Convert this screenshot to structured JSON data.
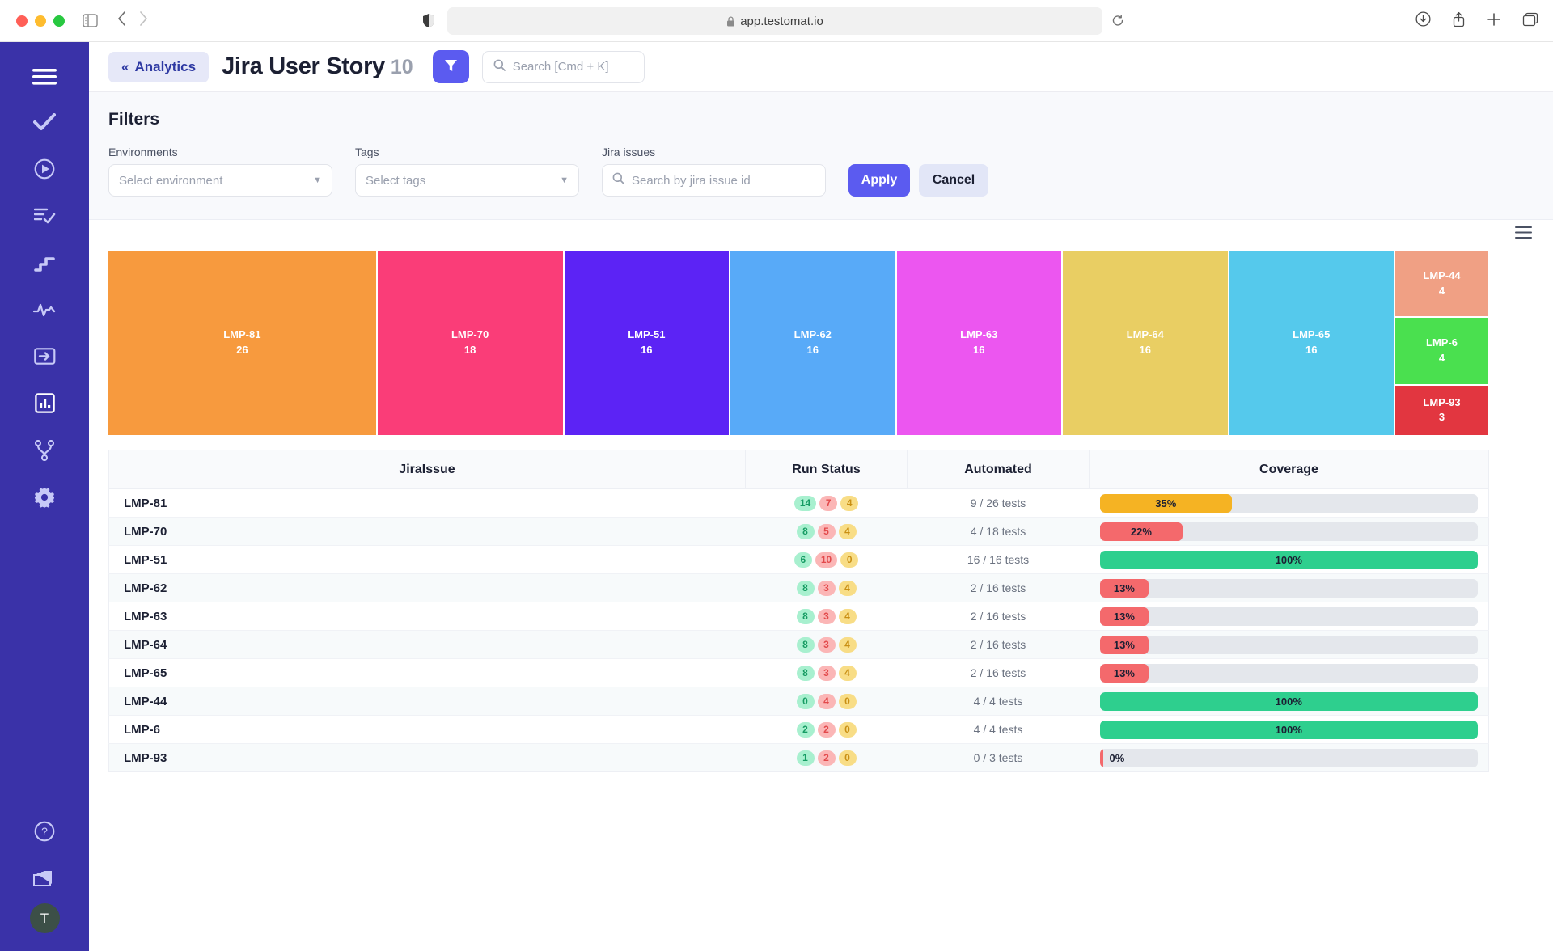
{
  "browser": {
    "url": "app.testomat.io",
    "lock_icon": "lock-icon",
    "shield_icon": "shield-icon",
    "sidebar_toggle_icon": "sidebar-toggle-icon",
    "back_icon": "back-arrow-icon",
    "forward_icon": "forward-arrow-icon",
    "reload_icon": "reload-icon",
    "download_icon": "download-icon",
    "share_icon": "share-icon",
    "new_tab_icon": "new-tab-icon",
    "tabs_icon": "tab-overview-icon"
  },
  "sidebar": {
    "items": [
      {
        "icon": "hamburger-menu-icon",
        "name": "menu"
      },
      {
        "icon": "check-icon",
        "name": "tests"
      },
      {
        "icon": "play-circle-icon",
        "name": "runs"
      },
      {
        "icon": "list-check-icon",
        "name": "plans"
      },
      {
        "icon": "stairs-icon",
        "name": "steps"
      },
      {
        "icon": "pulse-icon",
        "name": "activity"
      },
      {
        "icon": "import-icon",
        "name": "import"
      },
      {
        "icon": "bar-chart-icon",
        "name": "analytics"
      },
      {
        "icon": "branch-icon",
        "name": "branches"
      },
      {
        "icon": "gear-icon",
        "name": "settings"
      }
    ],
    "bottom": [
      {
        "icon": "help-circle-icon",
        "name": "help"
      },
      {
        "icon": "folder-icon",
        "name": "projects"
      }
    ],
    "avatar_initial": "T"
  },
  "header": {
    "breadcrumb_label": "Analytics",
    "breadcrumb_chevron": "«",
    "title": "Jira User Story",
    "count": "10",
    "filter_icon": "funnel-icon",
    "search_placeholder": "Search [Cmd + K]",
    "search_icon": "search-icon"
  },
  "filters": {
    "title": "Filters",
    "environments": {
      "label": "Environments",
      "value": "Select environment"
    },
    "tags": {
      "label": "Tags",
      "value": "Select tags"
    },
    "jira_issues": {
      "label": "Jira issues",
      "placeholder": "Search by jira issue id",
      "icon": "search-icon"
    },
    "apply_label": "Apply",
    "cancel_label": "Cancel",
    "apply_color": "#5b5bf0",
    "cancel_color": "#e2e6f7"
  },
  "chart_menu_icon": "chart-menu-icon",
  "chart_data": {
    "type": "treemap",
    "title": "Jira User Story",
    "label_key": "label",
    "value_key": "value",
    "tiles": [
      {
        "label": "LMP-81",
        "value": 26,
        "color": "#f79a3e"
      },
      {
        "label": "LMP-70",
        "value": 18,
        "color": "#fa3d78"
      },
      {
        "label": "LMP-51",
        "value": 16,
        "color": "#5c23f5"
      },
      {
        "label": "LMP-62",
        "value": 16,
        "color": "#58aaf8"
      },
      {
        "label": "LMP-63",
        "value": 16,
        "color": "#ec56f0"
      },
      {
        "label": "LMP-64",
        "value": 16,
        "color": "#e9ce63"
      },
      {
        "label": "LMP-65",
        "value": 16,
        "color": "#55c9ec"
      },
      {
        "label": "LMP-44",
        "value": 4,
        "color": "#f0a084"
      },
      {
        "label": "LMP-6",
        "value": 4,
        "color": "#4ae04f"
      },
      {
        "label": "LMP-93",
        "value": 3,
        "color": "#e23640"
      }
    ]
  },
  "table": {
    "columns": [
      "JiraIssue",
      "Run Status",
      "Automated",
      "Coverage"
    ],
    "rows": [
      {
        "issue": "LMP-81",
        "passed": "14",
        "failed": "7",
        "skipped": "4",
        "automated": "9 / 26 tests",
        "coverage_label": "35%",
        "coverage": 35,
        "coverage_color": "#f5b323"
      },
      {
        "issue": "LMP-70",
        "passed": "8",
        "failed": "5",
        "skipped": "4",
        "automated": "4 / 18 tests",
        "coverage_label": "22%",
        "coverage": 22,
        "coverage_color": "#f4696c"
      },
      {
        "issue": "LMP-51",
        "passed": "6",
        "failed": "10",
        "skipped": "0",
        "automated": "16 / 16 tests",
        "coverage_label": "100%",
        "coverage": 100,
        "coverage_color": "#2ecf8e"
      },
      {
        "issue": "LMP-62",
        "passed": "8",
        "failed": "3",
        "skipped": "4",
        "automated": "2 / 16 tests",
        "coverage_label": "13%",
        "coverage": 13,
        "coverage_color": "#f4696c"
      },
      {
        "issue": "LMP-63",
        "passed": "8",
        "failed": "3",
        "skipped": "4",
        "automated": "2 / 16 tests",
        "coverage_label": "13%",
        "coverage": 13,
        "coverage_color": "#f4696c"
      },
      {
        "issue": "LMP-64",
        "passed": "8",
        "failed": "3",
        "skipped": "4",
        "automated": "2 / 16 tests",
        "coverage_label": "13%",
        "coverage": 13,
        "coverage_color": "#f4696c"
      },
      {
        "issue": "LMP-65",
        "passed": "8",
        "failed": "3",
        "skipped": "4",
        "automated": "2 / 16 tests",
        "coverage_label": "13%",
        "coverage": 13,
        "coverage_color": "#f4696c"
      },
      {
        "issue": "LMP-44",
        "passed": "0",
        "failed": "4",
        "skipped": "0",
        "automated": "4 / 4 tests",
        "coverage_label": "100%",
        "coverage": 100,
        "coverage_color": "#2ecf8e"
      },
      {
        "issue": "LMP-6",
        "passed": "2",
        "failed": "2",
        "skipped": "0",
        "automated": "4 / 4 tests",
        "coverage_label": "100%",
        "coverage": 100,
        "coverage_color": "#2ecf8e"
      },
      {
        "issue": "LMP-93",
        "passed": "1",
        "failed": "2",
        "skipped": "0",
        "automated": "0 / 3 tests",
        "coverage_label": "0%",
        "coverage": 1,
        "coverage_color": "#f4696c"
      }
    ]
  }
}
